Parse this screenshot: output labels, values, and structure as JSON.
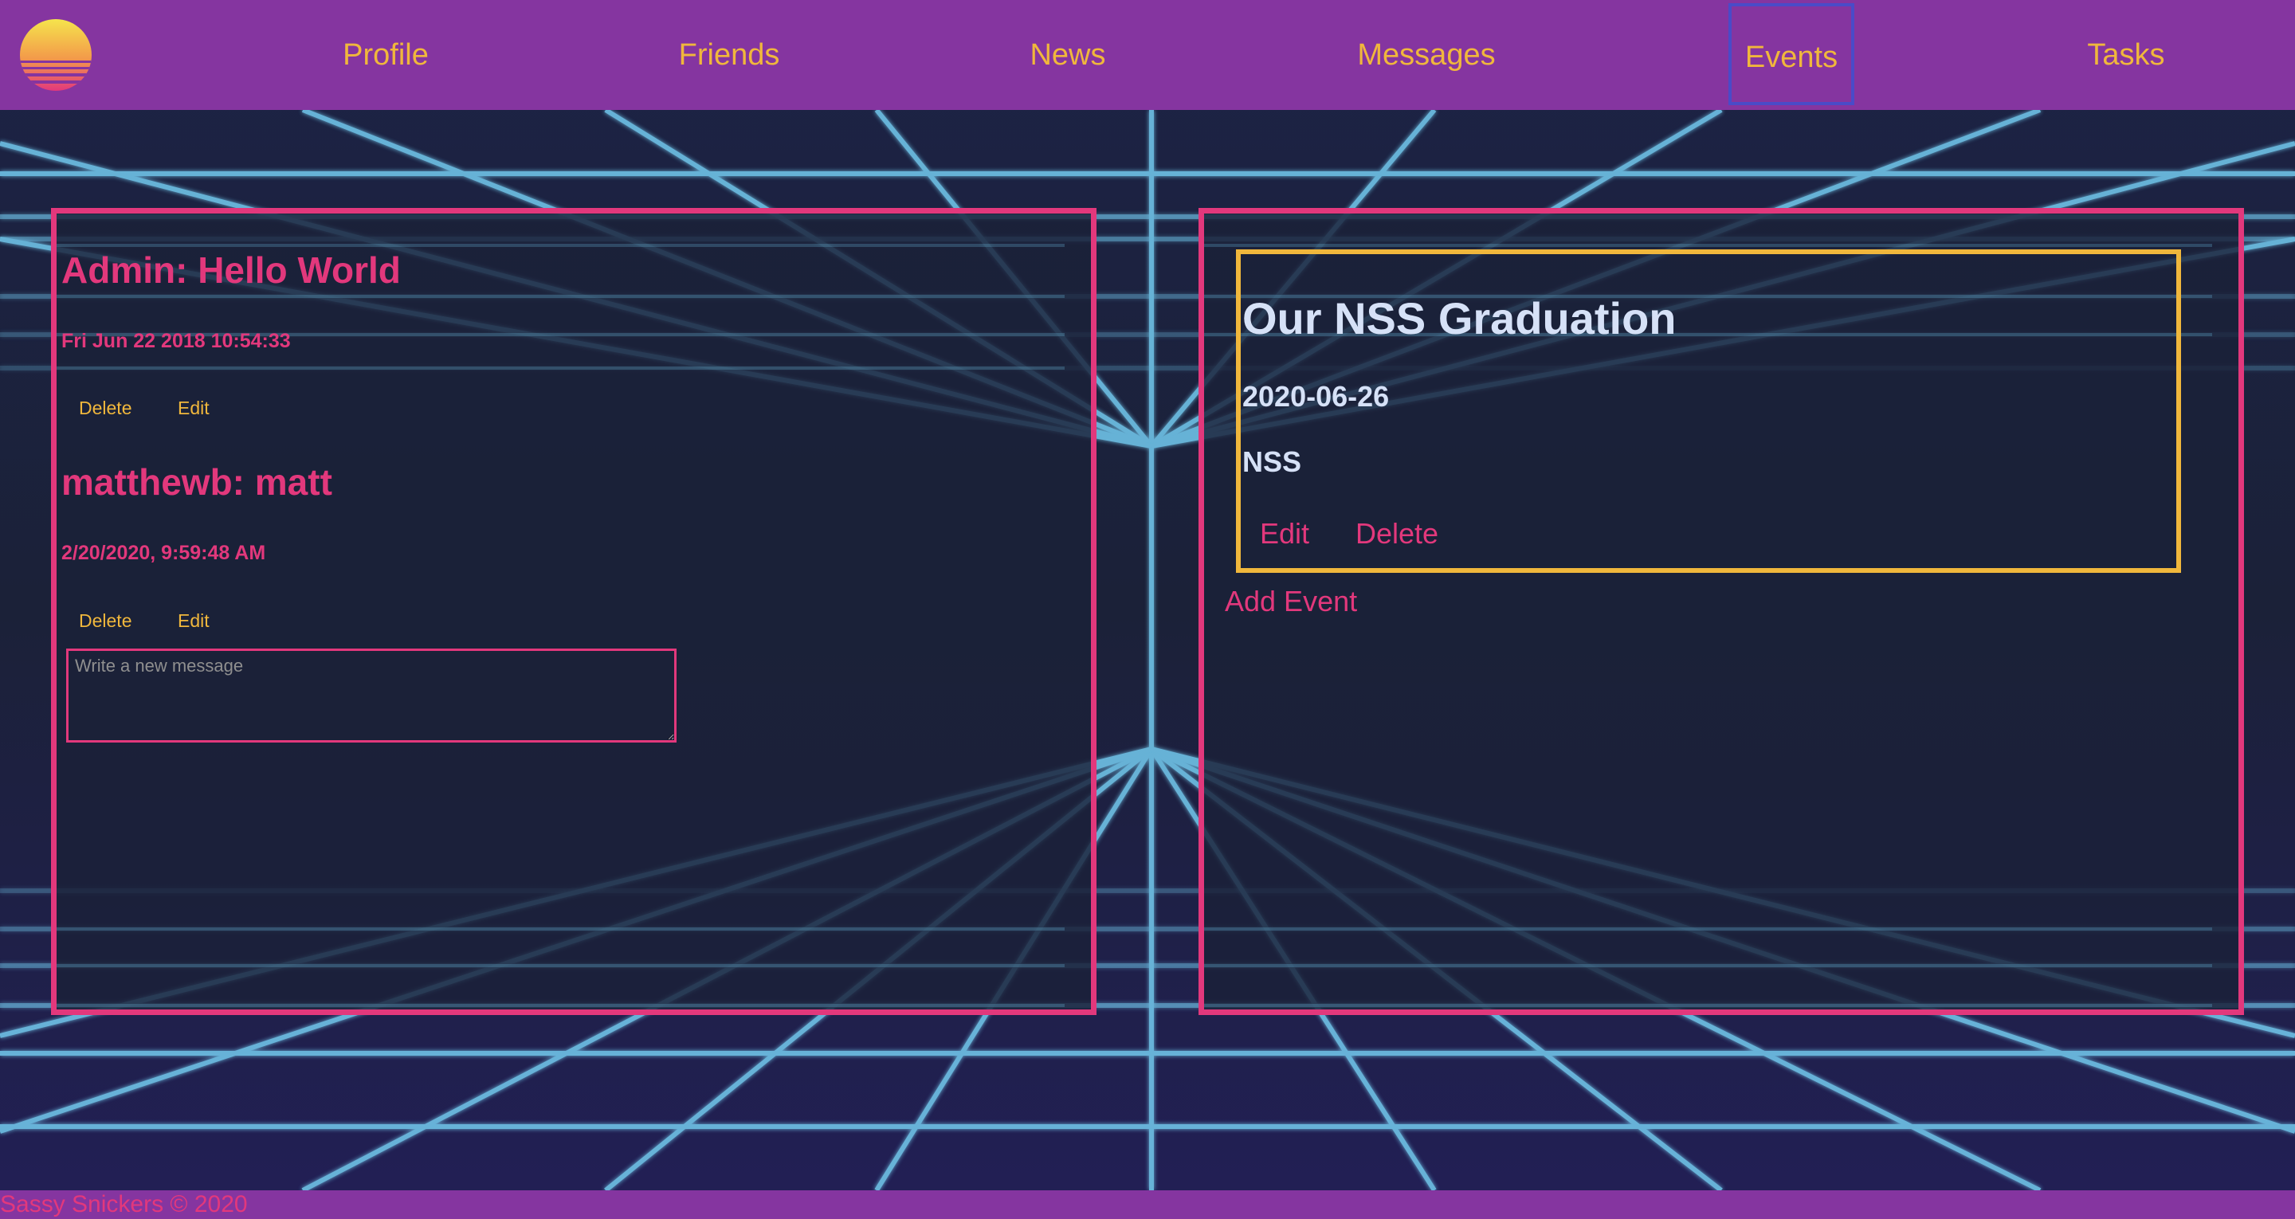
{
  "colors": {
    "nav_bg": "#8535a0",
    "nav_text": "#f0b73c",
    "active_border": "#4a4bc8",
    "accent_pink": "#e2387c",
    "accent_yellow": "#f0b73c",
    "page_bg": "#1b2138",
    "grid_line": "#6fc3e8",
    "event_text": "#d6e1f7"
  },
  "nav": {
    "logo_icon": "sunset-logo-icon",
    "items": [
      {
        "label": "Profile"
      },
      {
        "label": "Friends"
      },
      {
        "label": "News"
      },
      {
        "label": "Messages"
      },
      {
        "label": "Events",
        "active": true
      },
      {
        "label": "Tasks"
      }
    ]
  },
  "messages": {
    "items": [
      {
        "title": "Admin: Hello World",
        "date": "Fri Jun 22 2018 10:54:33",
        "delete_label": "Delete",
        "edit_label": "Edit"
      },
      {
        "title": "matthewb: matt",
        "date": "2/20/2020, 9:59:48 AM",
        "delete_label": "Delete",
        "edit_label": "Edit"
      }
    ],
    "new_message_placeholder": "Write a new message"
  },
  "events": {
    "items": [
      {
        "title": "Our NSS Graduation",
        "date": "2020-06-26",
        "location": "NSS",
        "edit_label": "Edit",
        "delete_label": "Delete"
      }
    ],
    "add_label": "Add Event"
  },
  "footer": {
    "text": "Sassy Snickers © 2020"
  }
}
